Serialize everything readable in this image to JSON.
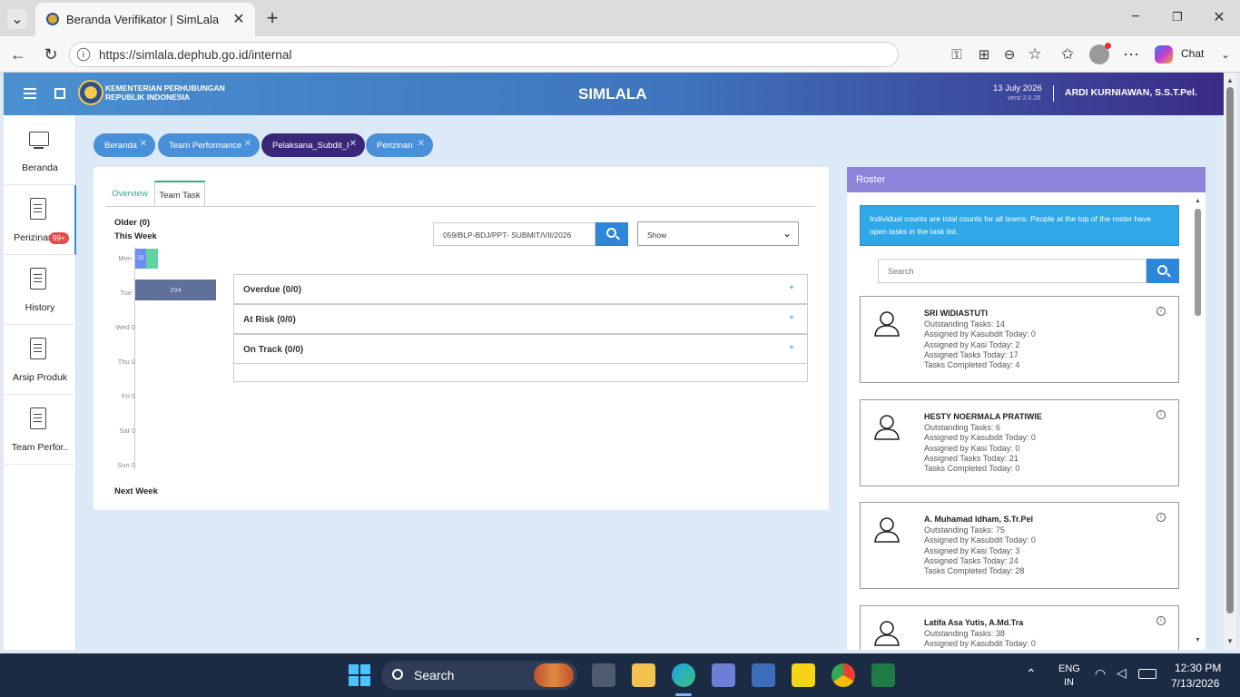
{
  "browser": {
    "tab_title": "Beranda Verifikator | SimLala",
    "url": "https://simlala.dephub.go.id/internal",
    "chat_label": "Chat"
  },
  "header": {
    "org_line1": "KEMENTERIAN PERHUBUNGAN",
    "org_line2": "REPUBLIK INDONESIA",
    "app_name": "SIMLALA",
    "date": "13 July 2026",
    "version": "versi 2.0.28",
    "user": "ARDI KURNIAWAN, S.S.T.Pel."
  },
  "sidebar": {
    "items": [
      {
        "label": "Beranda"
      },
      {
        "label": "Perizinan",
        "badge": "99+"
      },
      {
        "label": "History"
      },
      {
        "label": "Arsip Produk"
      },
      {
        "label": "Team Perfor.."
      }
    ]
  },
  "chips": [
    {
      "label": "Beranda",
      "color": "#4a90d9"
    },
    {
      "label": "Team Performance",
      "color": "#4a90d9"
    },
    {
      "label": "Pelaksana_Subdit_I",
      "color": "#3a2778"
    },
    {
      "label": "Perizinan",
      "color": "#4a90d9"
    }
  ],
  "main": {
    "tabs": [
      {
        "label": "Overview"
      },
      {
        "label": "Team Task"
      }
    ],
    "older": "Older (0)",
    "this_week": "This Week",
    "next_week": "Next Week",
    "days": [
      {
        "label": "Mon",
        "value": "38"
      },
      {
        "label": "Tue",
        "value": "294"
      },
      {
        "label": "Wed",
        "value": "0"
      },
      {
        "label": "Thu",
        "value": "0"
      },
      {
        "label": "Fri",
        "value": "0"
      },
      {
        "label": "Sat",
        "value": "0"
      },
      {
        "label": "Sun",
        "value": "0"
      }
    ],
    "search_value": "059/BLP-BDJ/PPT- SUBMIT/VII/2026",
    "show_select": "Show",
    "sections": [
      {
        "label": "Overdue (0/0)"
      },
      {
        "label": "At Risk (0/0)"
      },
      {
        "label": "On Track (0/0)"
      }
    ]
  },
  "roster": {
    "title": "Roster",
    "note": "Individual counts are total counts for all teams. People at the top of the roster have open tasks in the task list.",
    "search_placeholder": "Search",
    "people": [
      {
        "name": "SRI WIDIASTUTI",
        "lines": [
          "Outstanding Tasks: 14",
          "Assigned by Kasubdit Today: 0",
          "Assigned by Kasi Today: 2",
          "Assigned Tasks Today: 17",
          "Tasks Completed Today: 4"
        ]
      },
      {
        "name": "HESTY NOERMALA PRATIWIE",
        "lines": [
          "Outstanding Tasks: 6",
          "Assigned by Kasubdit Today: 0",
          "Assigned by Kasi Today: 0",
          "Assigned Tasks Today: 21",
          "Tasks Completed Today: 0"
        ]
      },
      {
        "name": "A. Muhamad Idham, S.Tr.Pel",
        "lines": [
          "Outstanding Tasks: 75",
          "Assigned by Kasubdit Today: 0",
          "Assigned by Kasi Today: 3",
          "Assigned Tasks Today: 24",
          "Tasks Completed Today: 28"
        ]
      },
      {
        "name": "Latifa Asa Yutis, A.Md.Tra",
        "lines": [
          "Outstanding Tasks: 38",
          "Assigned by Kasubdit Today: 0"
        ]
      }
    ]
  },
  "taskbar": {
    "search_label": "Search",
    "lang1": "ENG",
    "lang2": "IN",
    "time": "12:30 PM",
    "date": "7/13/2026"
  }
}
